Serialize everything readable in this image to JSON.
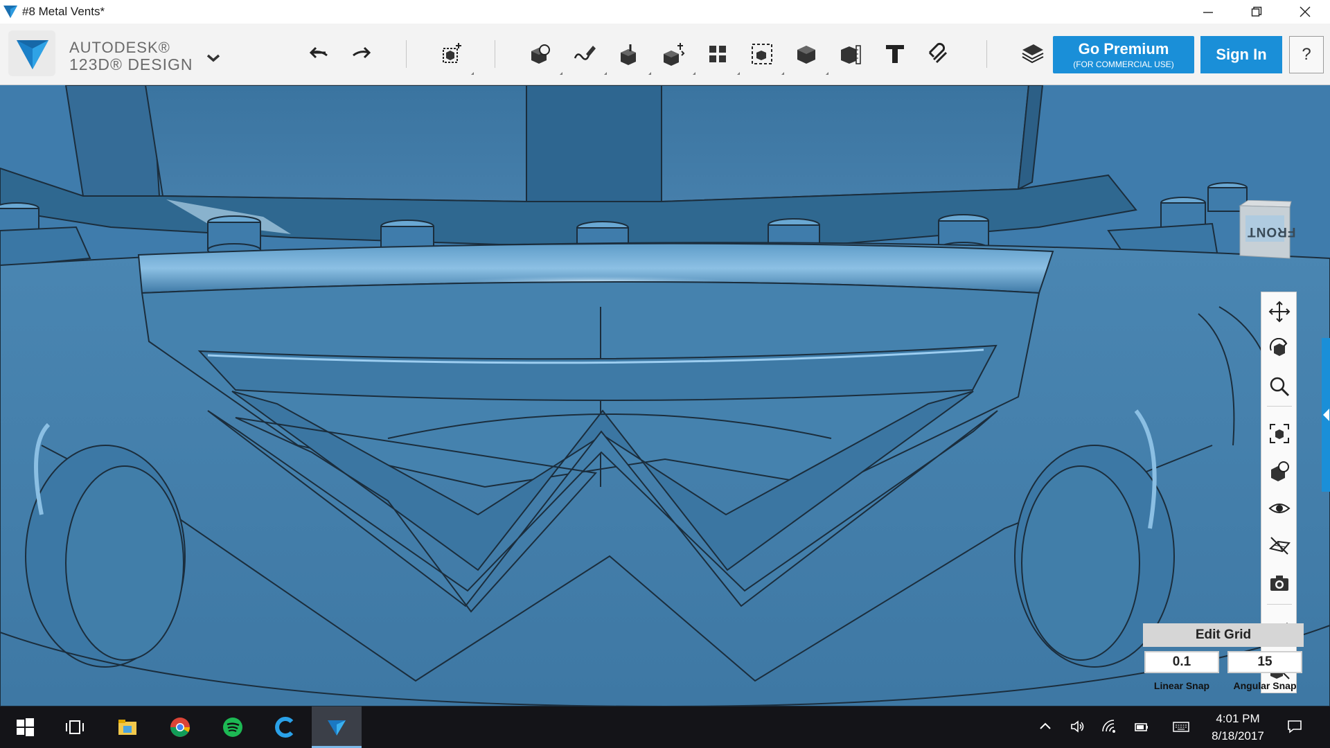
{
  "window": {
    "title": "#8 Metal Vents*",
    "controls": [
      "minimize",
      "restore",
      "close"
    ]
  },
  "brand": {
    "name_line1": "AUTODESK®",
    "name_line2": "123D® DESIGN"
  },
  "toolbar": {
    "tools": [
      {
        "id": "undo",
        "icon": "undo-arrow-icon"
      },
      {
        "id": "redo",
        "icon": "redo-arrow-icon"
      },
      {
        "id": "transform",
        "icon": "transform-cube-icon"
      },
      {
        "id": "primitives",
        "icon": "primitives-icon"
      },
      {
        "id": "sketch",
        "icon": "sketch-pencil-icon"
      },
      {
        "id": "construct",
        "icon": "construct-extrude-icon"
      },
      {
        "id": "modify",
        "icon": "modify-cube-icon"
      },
      {
        "id": "pattern",
        "icon": "pattern-grid-icon"
      },
      {
        "id": "grouping",
        "icon": "group-cubes-icon"
      },
      {
        "id": "combine",
        "icon": "combine-solid-icon"
      },
      {
        "id": "measure",
        "icon": "measure-ruler-icon"
      },
      {
        "id": "text",
        "icon": "text-t-icon",
        "label": "T"
      },
      {
        "id": "snap",
        "icon": "magnet-snap-icon"
      },
      {
        "id": "materials",
        "icon": "layers-stack-icon"
      }
    ],
    "premium": {
      "label": "Go Premium",
      "sublabel": "(FOR COMMERCIAL USE)"
    },
    "signin": "Sign In",
    "help": "?"
  },
  "viewcube": {
    "face_label": "FRONT"
  },
  "navbar": {
    "items": [
      {
        "id": "pan",
        "icon": "pan-arrows-icon"
      },
      {
        "id": "orbit",
        "icon": "orbit-icon"
      },
      {
        "id": "zoom",
        "icon": "zoom-magnifier-icon"
      },
      {
        "id": "fit",
        "icon": "fit-view-icon"
      },
      {
        "id": "views",
        "icon": "view-style-icon"
      },
      {
        "id": "visibility",
        "icon": "eye-icon"
      },
      {
        "id": "grid",
        "icon": "grid-toggle-icon"
      },
      {
        "id": "screenshot",
        "icon": "camera-icon"
      },
      {
        "id": "material",
        "icon": "material-snap-icon"
      },
      {
        "id": "hide",
        "icon": "hide-snap-icon"
      }
    ]
  },
  "grid": {
    "title": "Edit Grid",
    "linear_value": "0.1",
    "angular_value": "15",
    "linear_label": "Linear Snap",
    "angular_label": "Angular Snap"
  },
  "colors": {
    "accent": "#1a8fd8",
    "model_blue": "#3d7cab",
    "taskbar": "#141418"
  },
  "taskbar": {
    "apps": [
      {
        "id": "start",
        "icon": "windows-logo-icon"
      },
      {
        "id": "taskview",
        "icon": "task-view-icon"
      },
      {
        "id": "explorer",
        "icon": "folder-icon"
      },
      {
        "id": "chrome",
        "icon": "chrome-icon"
      },
      {
        "id": "spotify",
        "icon": "spotify-icon"
      },
      {
        "id": "ccleaner",
        "icon": "ccleaner-icon"
      },
      {
        "id": "123d",
        "icon": "123d-design-icon",
        "active": true
      }
    ],
    "tray": [
      {
        "id": "show-hidden",
        "icon": "chevron-up-icon"
      },
      {
        "id": "volume",
        "icon": "volume-icon"
      },
      {
        "id": "wifi",
        "icon": "wifi-icon"
      },
      {
        "id": "battery",
        "icon": "battery-icon"
      },
      {
        "id": "keyboard",
        "icon": "keyboard-icon"
      },
      {
        "id": "notifications",
        "icon": "action-center-icon"
      }
    ],
    "time": "4:01 PM",
    "date": "8/18/2017"
  }
}
